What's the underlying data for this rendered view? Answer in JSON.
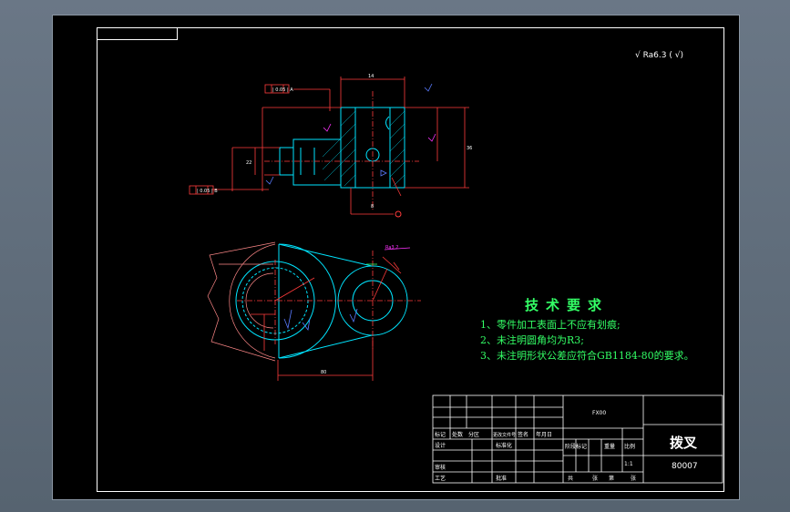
{
  "technical_requirements": {
    "title": "技术要求",
    "items": [
      "1、零件加工表面上不应有划痕;",
      "2、未注明圆角均为R3;",
      "3、未注明形状公差应符合GB1184-80的要求。"
    ]
  },
  "roughness_note": "√ Ra6.3 ( √)",
  "title_block": {
    "part_name": "拨叉",
    "drawing_number": "80007",
    "firm_label": "FX00",
    "scale": "1:1",
    "labels": {
      "mark": "标记",
      "count": "处数",
      "zone": "分区",
      "change_doc": "更改文件号",
      "signature": "签名",
      "date": "年月日",
      "designer": "设计",
      "standardize": "标准化",
      "stage_mark": "阶段标记",
      "weight": "重量",
      "scale_label": "比例",
      "checker": "审核",
      "craft": "工艺",
      "approve": "批准",
      "shared": "共",
      "sheet": "张",
      "page": "第",
      "page2": "张"
    }
  },
  "dimensions": {
    "top_width": "14",
    "height_right": "36",
    "height_left": "22",
    "bottom_offset": "8",
    "center_distance": "80",
    "gdt_top": "| 0.05 | A",
    "gdt_left": "| 0.05 | B",
    "surface_mark": "Ra3.2",
    "datum_a": "A",
    "datum_b": "B"
  },
  "colors": {
    "outline": "#00e5ff",
    "dimension": "#ff3b3b",
    "centerline": "#ff3b3b",
    "text_green": "#33ff66",
    "magenta": "#ff33ff"
  }
}
